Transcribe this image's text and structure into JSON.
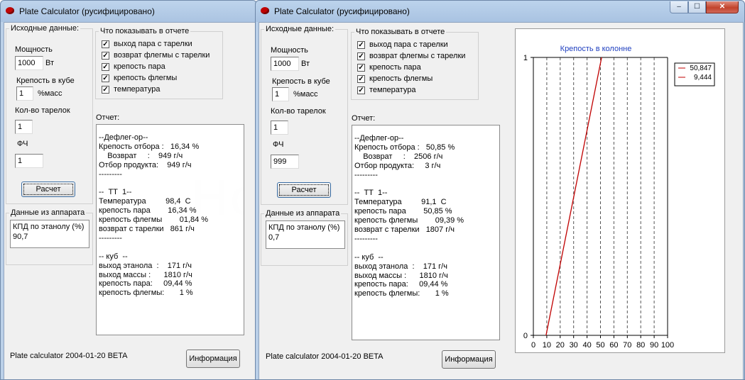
{
  "window_title": "Plate Calculator (русифицировано)",
  "watermark": "HomeDistiller.ru",
  "labels": {
    "inputs_group": "Исходные данные:",
    "power": "Мощность",
    "power_unit": "Вт",
    "cube_strength": "Крепость в кубе",
    "cube_unit": "%масс",
    "plates": "Кол-во тарелок",
    "fch": "ФЧ",
    "calc_button": "Расчет",
    "device_group": "Данные из аппарата",
    "efficiency_label": "КПД по этанолу (%)",
    "report_options_group": "Что показывать в отчете",
    "report_label": "Отчет:",
    "status": "Plate calculator 2004-01-20 BETA",
    "info_button": "Информация"
  },
  "checkboxes": [
    {
      "label": "выход пара с тарелки",
      "checked": true
    },
    {
      "label": "возврат флегмы с тарелки",
      "checked": true
    },
    {
      "label": "крепость пара",
      "checked": true
    },
    {
      "label": "крепость флегмы",
      "checked": true
    },
    {
      "label": "температура",
      "checked": true
    }
  ],
  "window1": {
    "inputs": {
      "power": "1000",
      "cube_strength": "1",
      "plates": "1",
      "fch": "1"
    },
    "efficiency": "90,7",
    "report": [
      "--Дефлег-ор--",
      "Крепость отбора :   16,34 %",
      "    Возврат     :    949 г/ч",
      "Отбор продукта:    949 г/ч",
      "---------",
      "",
      "--  ТТ  1--",
      "Температура         98,4  С",
      "крепость пара        16,34 %",
      "крепость флегмы        01,84 %",
      "возврат с тарелки   861 г/ч",
      "---------",
      "",
      "-- куб  --",
      "выход этанола  :    171 г/ч",
      "выход массы :      1810 г/ч",
      "крепость пара:     09,44 %",
      "крепость флегмы:       1 %"
    ]
  },
  "window2": {
    "inputs": {
      "power": "1000",
      "cube_strength": "1",
      "plates": "1",
      "fch": "999"
    },
    "efficiency": "0,7",
    "report": [
      "--Дефлег-ор--",
      "Крепость отбора :   50,85 %",
      "    Возврат     :    2506 г/ч",
      "Отбор продукта:     3 г/ч",
      "---------",
      "",
      "--  ТТ  1--",
      "Температура         91,1  С",
      "крепость пара        50,85 %",
      "крепость флегмы        09,39 %",
      "возврат с тарелки   1807 г/ч",
      "---------",
      "",
      "-- куб  --",
      "выход этанола  :    171 г/ч",
      "выход массы :      1810 г/ч",
      "крепость пара:     09,44 %",
      "крепость флегмы:       1 %"
    ]
  },
  "window_controls": {
    "minimize": "‒",
    "maximize": "☐",
    "close": "✕"
  },
  "chart_data": {
    "type": "line",
    "title": "Крепость в колонне",
    "xlim": [
      0,
      100
    ],
    "ylim": [
      0,
      1
    ],
    "x_ticks": [
      "0",
      "10",
      "20",
      "30",
      "40",
      "50",
      "60",
      "70",
      "80",
      "90",
      "100"
    ],
    "y_ticks": [
      "0",
      "1"
    ],
    "grid": true,
    "legend_position": "top-right",
    "series": [
      {
        "name": "50,847",
        "points": [
          [
            9.444,
            0
          ],
          [
            50.847,
            1
          ]
        ],
        "color": "#c00000"
      }
    ],
    "legend": [
      "50,847",
      "9,444"
    ]
  }
}
